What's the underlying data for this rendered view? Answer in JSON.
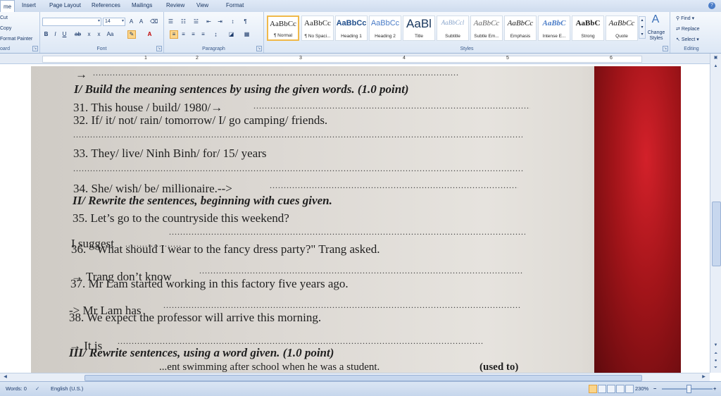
{
  "ribbon": {
    "tabs": [
      "me",
      "Insert",
      "Page Layout",
      "References",
      "Mailings",
      "Review",
      "View",
      "Format"
    ],
    "clipboard": {
      "cut": "Cut",
      "copy": "Copy",
      "format_painter": "Format Painter",
      "label": "oard"
    },
    "font": {
      "size": "14",
      "label": "Font"
    },
    "paragraph": {
      "label": "Paragraph"
    },
    "styles": {
      "label": "Styles",
      "change_styles": "Change Styles",
      "items": [
        {
          "sample": "AaBbCc",
          "name": "¶ Normal"
        },
        {
          "sample": "AaBbCc",
          "name": "¶ No Spaci..."
        },
        {
          "sample": "AaBbCc",
          "name": "Heading 1"
        },
        {
          "sample": "AaBbCc",
          "name": "Heading 2"
        },
        {
          "sample": "AaBl",
          "name": "Title"
        },
        {
          "sample": "AaBbCcl",
          "name": "Subtitle"
        },
        {
          "sample": "AaBbCc",
          "name": "Subtle Em..."
        },
        {
          "sample": "AaBbCc",
          "name": "Emphasis"
        },
        {
          "sample": "AaBbC",
          "name": "Intense E..."
        },
        {
          "sample": "AaBbC",
          "name": "Strong"
        },
        {
          "sample": "AaBbCc",
          "name": "Quote"
        }
      ]
    },
    "editing": {
      "find": "Find",
      "replace": "Replace",
      "select": "Select",
      "label": "Editing"
    }
  },
  "ruler": {
    "numbers": [
      "1",
      "2",
      "3",
      "4",
      "5",
      "6"
    ]
  },
  "document": {
    "lines": [
      {
        "text": "→",
        "style": "n"
      },
      {
        "text": "I/ Build the meaning sentences by using the given words. (1.0 point)",
        "style": "h"
      },
      {
        "text": "31. This house / build/ 1980/→",
        "style": "n"
      },
      {
        "text": "32. If/ it/ not/ rain/ tomorrow/ I/ go camping/ friends.",
        "style": "n"
      },
      {
        "text": "33. They/ live/ Ninh Binh/ for/ 15/ years",
        "style": "n"
      },
      {
        "text": "34. She/ wish/ be/ millionaire.-->",
        "style": "n"
      },
      {
        "text": "II/ Rewrite the sentences, beginning with cues given.",
        "style": "h"
      },
      {
        "text": "35. Let’s go to the countryside this weekend?",
        "style": "n"
      },
      {
        "text": "I suggest",
        "style": "n"
      },
      {
        "text": "36. \" What should I wear to the fancy dress party?\" Trang asked.",
        "style": "n"
      },
      {
        "text": "→ Trang don’t know",
        "style": "n"
      },
      {
        "text": "37. Mr Lam started working in this factory five years ago.",
        "style": "n"
      },
      {
        "text": "-> Mr Lam has",
        "style": "n"
      },
      {
        "text": "38. We expect the professor will  arrive this morning.",
        "style": "n"
      },
      {
        "text": "→ It is",
        "style": "n"
      },
      {
        "text": "III/ Rewrite sentences, using a word given. (1.0 point)",
        "style": "h"
      },
      {
        "text": "...ent swimming after school when he was a student.",
        "style": "n"
      },
      {
        "text": "(used to)",
        "style": "n"
      }
    ]
  },
  "status": {
    "words": "Words: 0",
    "language": "English (U.S.)",
    "zoom": "230%"
  },
  "colors": {
    "accent": "#f0b94a",
    "ribbon_blue": "#dce7f5",
    "cloth_red": "#a11419"
  }
}
